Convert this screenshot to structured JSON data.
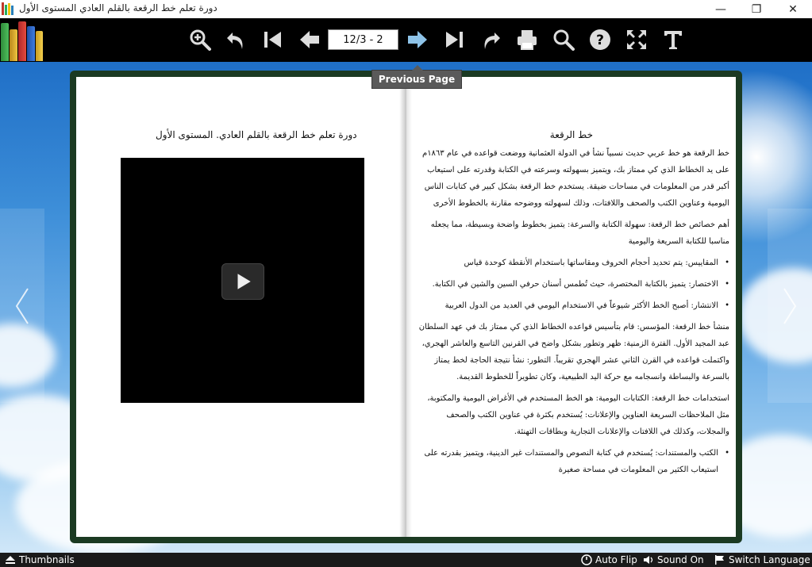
{
  "window": {
    "title": "دورة تعلم خط الرقعة بالقلم العادي المستوى الأول",
    "minimize": "—",
    "maximize": "❐",
    "close": "✕"
  },
  "toolbar": {
    "page_input_value": "12/3 - 2"
  },
  "tooltip": "Previous Page",
  "left_page": {
    "heading": "دورة تعلم خط الرقعة بالقلم العادي. المستوى الأول"
  },
  "right_page": {
    "heading": "خط الرقعة",
    "paragraphs": [
      "خط الرقعة هو خط عربي حديث نسبياً نشأ في الدولة العثمانية ووضعت قواعده في عام ١٨٦٣م على يد الخطاط الذي كي ممتاز بك، ويتميز بسهولته وسرعته في الكتابة وقدرته على استيعاب أكبر قدر من المعلومات في مساحات ضيقة. يستخدم خط الرقعة بشكل كبير في كتابات الناس اليومية وعناوين الكتب والصحف واللافتات، وذلك لسهولته ووضوحه مقارنة بالخطوط الأخرى",
      "أهم خصائص خط الرقعة: سهولة الكتابة والسرعة: يتميز بخطوط واضحة وبسيطة، مما يجعله مناسبا للكتابة السريعة واليومية"
    ],
    "bullets1": [
      "المقاييس: يتم تحديد أحجام الحروف ومقاساتها باستخدام الأنقطة كوحدة قياس",
      "الاختصار: يتميز بالكتابة المختصرة، حيث تُطمس أسنان حرفي السين والشين في الكتابة.",
      "الانتشار: أصبح الخط الأكثر شيوعاً في الاستخدام اليومي في العديد من الدول العربية"
    ],
    "paragraphs2": [
      "منشأ خط الرقعة: المؤسس: قام بتأسيس قواعده الخطاط الذي كي ممتاز بك في عهد السلطان عبد المجيد الأول. الفترة الزمنية: ظهر وتطور بشكل واضح في القرنين التاسع والعاشر الهجري، واكتملت قواعده في القرن الثاني عشر الهجري تقريباً. التطور: نشأ نتيجة الحاجة لخط يمتاز بالسرعة والبساطة وانسجامه مع حركة اليد الطبيعية، وكان تطويراً للخطوط القديمة.",
      "استخدامات خط الرقعة: الكتابات اليومية: هو الخط المستخدم في الأغراض اليومية والمكتوبة، مثل الملاحظات السريعة العناوين والإعلانات: يُستخدم بكثرة في عناوين الكتب والصحف والمجلات، وكذلك في اللافتات والإعلانات التجارية وبطاقات التهنئة."
    ],
    "bullets2": [
      "الكتب والمستندات: يُستخدم في كتابة النصوص والمستندات غير الدينية، ويتميز بقدرته على استيعاب الكثير من المعلومات في مساحة صغيرة"
    ]
  },
  "bottombar": {
    "thumbnails": "Thumbnails",
    "auto_flip": "Auto Flip",
    "sound": "Sound On",
    "language": "Switch Language"
  },
  "icons": {
    "toolbar": [
      "zoom-in-icon",
      "undo-icon",
      "first-page-icon",
      "previous-page-icon",
      "next-page-icon",
      "last-page-icon",
      "redo-icon",
      "print-icon",
      "search-icon",
      "help-icon",
      "fullscreen-icon",
      "text-icon"
    ]
  },
  "colors": {
    "toolbar_bg": "#000000",
    "book_border": "#1b3a22",
    "sky_top": "#1f6fc7",
    "tooltip_bg": "#5a5a5a"
  }
}
